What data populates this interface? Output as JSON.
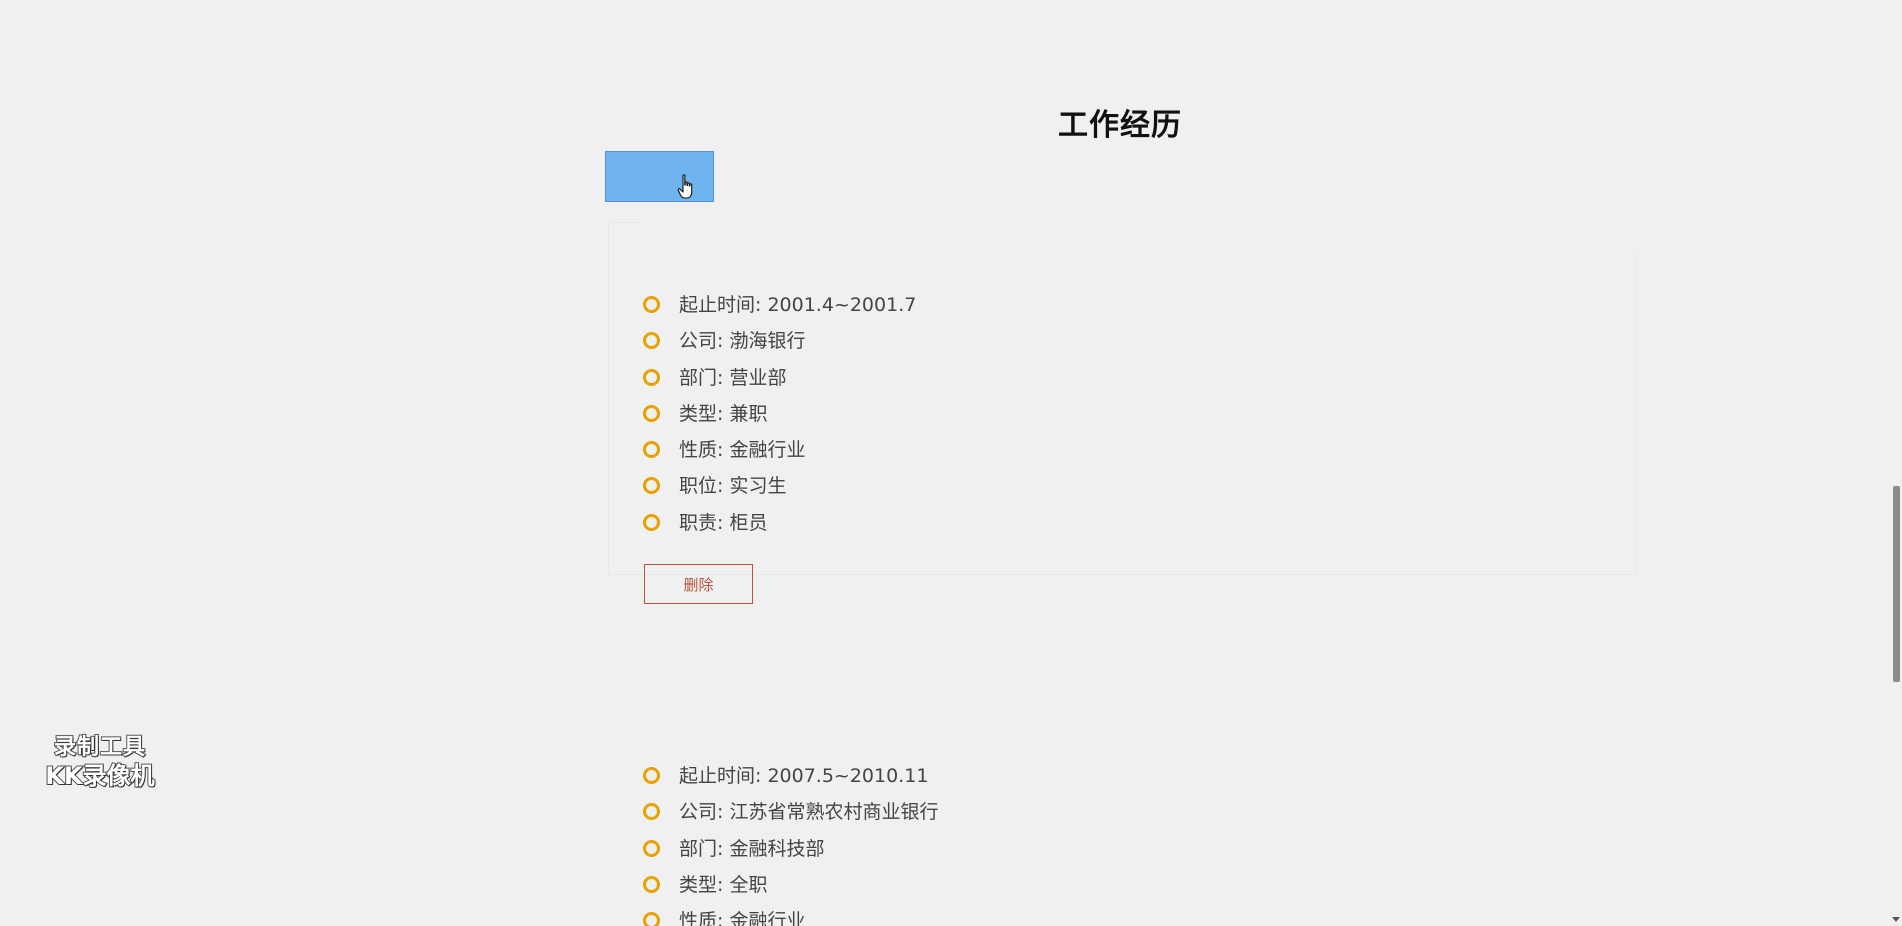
{
  "section": {
    "title": "工作经历"
  },
  "add_button": {
    "label": ""
  },
  "entries": [
    {
      "items": [
        "起止时间: 2001.4~2001.7",
        "公司: 渤海银行",
        "部门: 营业部",
        "类型: 兼职",
        "性质: 金融行业",
        "职位: 实习生",
        "职责: 柜员"
      ],
      "delete_label": "删除"
    },
    {
      "items": [
        "起止时间: 2007.5~2010.11",
        "公司: 江苏省常熟农村商业银行",
        "部门: 金融科技部",
        "类型: 全职",
        "性质: 金融行业"
      ]
    }
  ],
  "watermark": {
    "line1": "录制工具",
    "line2": "KK录像机"
  },
  "colors": {
    "background": "#eff0ef",
    "add_button": "#6fb4ef",
    "bullet": "#e6a200",
    "delete_button": "#b5533c"
  }
}
